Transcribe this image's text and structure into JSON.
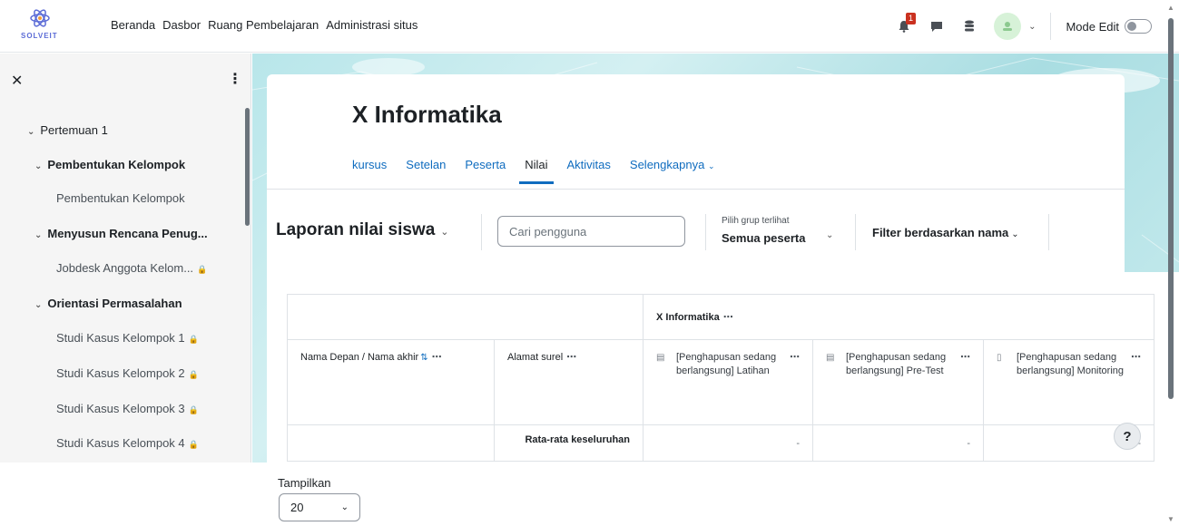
{
  "brand": {
    "logo_text": "SOLVEIT"
  },
  "nav": {
    "links": [
      "Beranda",
      "Dasbor",
      "Ruang Pembelajaran",
      "Administrasi situs"
    ],
    "notification_count": "1",
    "mode_edit_label": "Mode Edit"
  },
  "sidebar": {
    "sections": [
      {
        "label": "Pertemuan 1",
        "type": "section"
      },
      {
        "label": "Pembentukan Kelompok",
        "type": "section"
      },
      {
        "label": "Pembentukan Kelompok",
        "type": "sub",
        "locked": false
      },
      {
        "label": "Menyusun Rencana Penug...",
        "type": "section"
      },
      {
        "label": "Jobdesk Anggota Kelom...",
        "type": "sub",
        "locked": true
      },
      {
        "label": "Orientasi Permasalahan",
        "type": "section"
      },
      {
        "label": "Studi Kasus Kelompok 1",
        "type": "sub",
        "locked": true
      },
      {
        "label": "Studi Kasus Kelompok 2",
        "type": "sub",
        "locked": true
      },
      {
        "label": "Studi Kasus Kelompok 3",
        "type": "sub",
        "locked": true
      },
      {
        "label": "Studi Kasus Kelompok 4",
        "type": "sub",
        "locked": true
      }
    ]
  },
  "course": {
    "title": "X Informatika",
    "tabs": [
      "kursus",
      "Setelan",
      "Peserta",
      "Nilai",
      "Aktivitas",
      "Selengkapnya"
    ],
    "active_tab": "Nilai"
  },
  "report": {
    "title": "Laporan nilai siswa",
    "search_placeholder": "Cari pengguna",
    "group_label": "Pilih grup terlihat",
    "group_value": "Semua peserta",
    "filter_label": "Filter berdasarkan nama"
  },
  "grades_table": {
    "category_header": "X Informatika",
    "col_name": "Nama Depan / Nama akhir",
    "col_email": "Alamat surel",
    "items": [
      "[Penghapusan sedang berlangsung] Latihan",
      "[Penghapusan sedang berlangsung] Pre-Test",
      "[Penghapusan sedang berlangsung] Monitoring"
    ],
    "overall_label": "Rata-rata keseluruhan",
    "overall_values": [
      "-",
      "-",
      "-"
    ]
  },
  "footer": {
    "show_label": "Tampilkan",
    "show_value": "20"
  },
  "help_label": "?"
}
